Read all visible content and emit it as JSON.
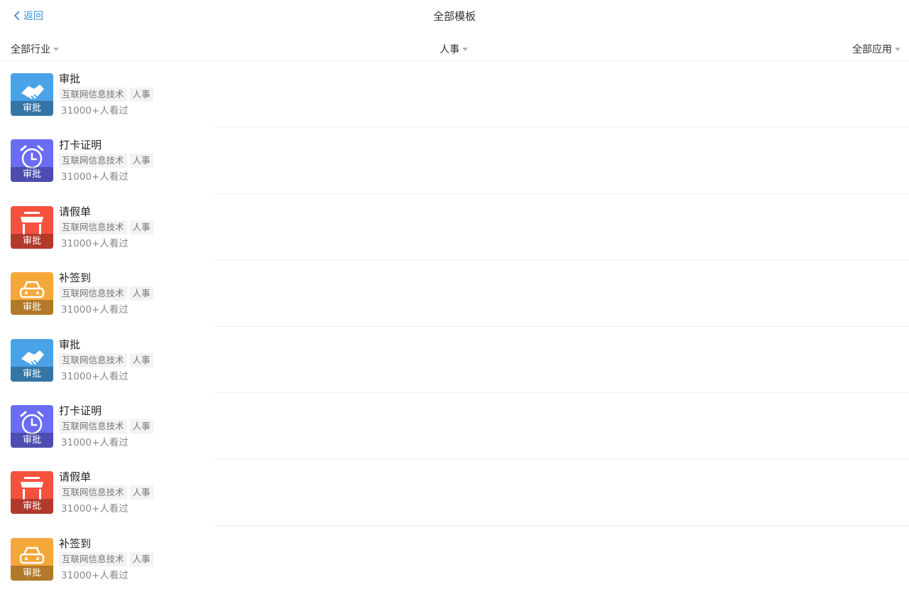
{
  "nav": {
    "back_label": "返回",
    "title": "全部模板"
  },
  "filters": {
    "industry": "全部行业",
    "category": "人事",
    "app": "全部应用"
  },
  "colors": {
    "accent": "#3a8fd6",
    "blue": "#4aa3e6",
    "purple": "#6b6bf5",
    "red": "#f5513f",
    "orange": "#f5a83a"
  },
  "templates": [
    {
      "title": "审批",
      "icon": "handshake-icon",
      "color": "#4aa3e6",
      "band": "审批",
      "tags": [
        "互联网信息技术",
        "人事"
      ],
      "views": "31000+人看过"
    },
    {
      "title": "打卡证明",
      "icon": "alarm-clock-icon",
      "color": "#6b6bf5",
      "band": "审批",
      "tags": [
        "互联网信息技术",
        "人事"
      ],
      "views": "31000+人看过"
    },
    {
      "title": "请假单",
      "icon": "shop-icon",
      "color": "#f5513f",
      "band": "审批",
      "tags": [
        "互联网信息技术",
        "人事"
      ],
      "views": "31000+人看过"
    },
    {
      "title": "补签到",
      "icon": "car-icon",
      "color": "#f5a83a",
      "band": "审批",
      "tags": [
        "互联网信息技术",
        "人事"
      ],
      "views": "31000+人看过"
    },
    {
      "title": "审批",
      "icon": "handshake-icon",
      "color": "#4aa3e6",
      "band": "审批",
      "tags": [
        "互联网信息技术",
        "人事"
      ],
      "views": "31000+人看过"
    },
    {
      "title": "打卡证明",
      "icon": "alarm-clock-icon",
      "color": "#6b6bf5",
      "band": "审批",
      "tags": [
        "互联网信息技术",
        "人事"
      ],
      "views": "31000+人看过"
    },
    {
      "title": "请假单",
      "icon": "shop-icon",
      "color": "#f5513f",
      "band": "审批",
      "tags": [
        "互联网信息技术",
        "人事"
      ],
      "views": "31000+人看过"
    },
    {
      "title": "补签到",
      "icon": "car-icon",
      "color": "#f5a83a",
      "band": "审批",
      "tags": [
        "互联网信息技术",
        "人事"
      ],
      "views": "31000+人看过"
    }
  ]
}
